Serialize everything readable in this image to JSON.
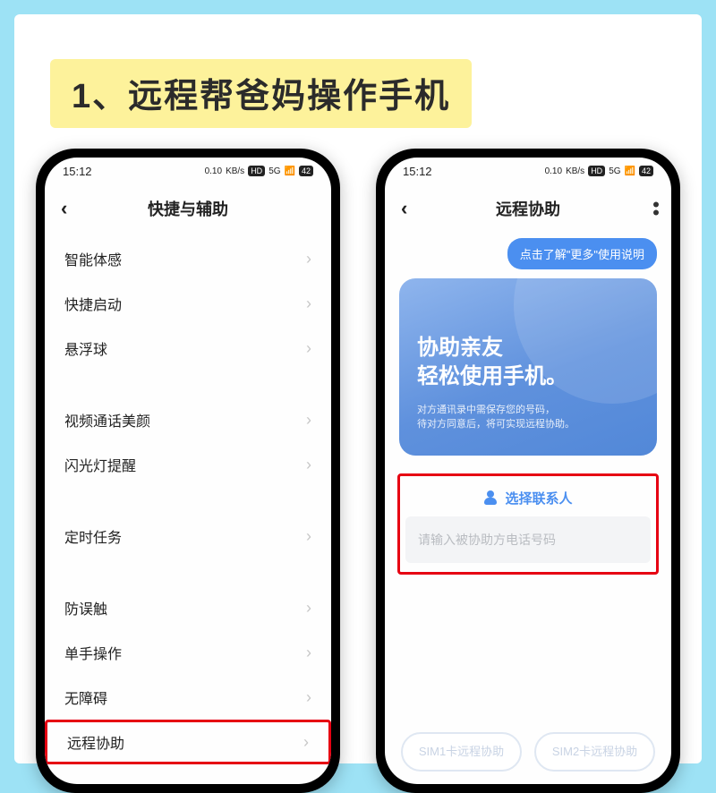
{
  "banner": {
    "title": "1、远程帮爸妈操作手机"
  },
  "statusbar": {
    "time": "15:12",
    "net_speed": "0.10",
    "net_unit": "KB/s",
    "hd": "HD",
    "sig": "5G",
    "battery": "42"
  },
  "phone1": {
    "header": {
      "title": "快捷与辅助"
    },
    "groups": [
      {
        "items": [
          {
            "label": "智能体感"
          },
          {
            "label": "快捷启动"
          },
          {
            "label": "悬浮球"
          }
        ]
      },
      {
        "items": [
          {
            "label": "视频通话美颜"
          },
          {
            "label": "闪光灯提醒"
          }
        ]
      },
      {
        "items": [
          {
            "label": "定时任务"
          }
        ]
      },
      {
        "items": [
          {
            "label": "防误触"
          },
          {
            "label": "单手操作"
          },
          {
            "label": "无障碍"
          },
          {
            "label": "远程协助",
            "highlight": true
          }
        ]
      }
    ]
  },
  "phone2": {
    "header": {
      "title": "远程协助"
    },
    "tip": "点击了解\"更多\"使用说明",
    "hero": {
      "line1": "协助亲友",
      "line2": "轻松使用手机。",
      "sub1": "对方通讯录中需保存您的号码，",
      "sub2": "待对方同意后，将可实现远程协助。"
    },
    "contact": {
      "select_label": "选择联系人",
      "input_placeholder": "请输入被协助方电话号码"
    },
    "sim": {
      "sim1": "SIM1卡远程协助",
      "sim2": "SIM2卡远程协助"
    }
  }
}
